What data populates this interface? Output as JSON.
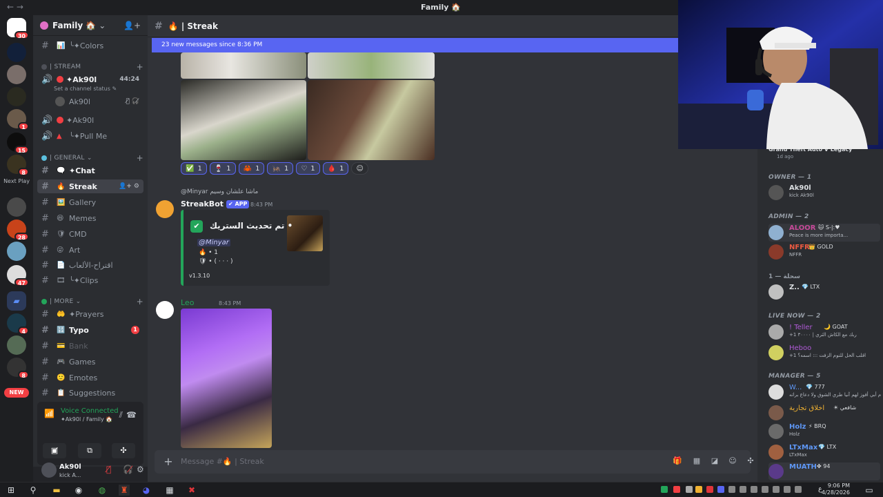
{
  "window": {
    "title": "Family 🏠",
    "nav": "←  →"
  },
  "servers": {
    "badges": [
      "30",
      "1",
      "15",
      "8",
      "28",
      "47",
      "4",
      "8"
    ],
    "next_play": "Next Play",
    "new_label": "NEW"
  },
  "guild": {
    "name": "Family 🏠",
    "chevron": "⌄"
  },
  "channels": [
    {
      "emoji": "📊",
      "label": "╰✦Colors"
    },
    {
      "emoji": "🗨️",
      "label": "✦Chat"
    },
    {
      "emoji": "🔥",
      "label": "Streak"
    },
    {
      "emoji": "🖼️",
      "label": "Gallery"
    },
    {
      "emoji": "😆",
      "label": "Memes"
    },
    {
      "emoji": "🛡",
      "label": "CMD"
    },
    {
      "emoji": "😜",
      "label": "Art"
    },
    {
      "emoji": "📄",
      "label": "اقتراح-الألعاب"
    },
    {
      "emoji": "🎞",
      "label": "╰✦Clips"
    },
    {
      "emoji": "🤲",
      "label": "✦Prayers"
    },
    {
      "emoji": "🔢",
      "label": "Typo"
    },
    {
      "emoji": "💳",
      "label": "Bank"
    },
    {
      "emoji": "🎮",
      "label": "Games"
    },
    {
      "emoji": "🙂",
      "label": "Emotes"
    },
    {
      "emoji": "📋",
      "label": "Suggestions"
    }
  ],
  "categories": {
    "stream": "| STREAM",
    "general": "| GENERAL ⌄",
    "more": "| MORE ⌄"
  },
  "voice_channels": [
    {
      "label": "✦Ak90l",
      "time": "44:24",
      "status": "Set a channel status ✎"
    },
    {
      "label": "✦Ak90l"
    },
    {
      "label": "╰✦Pull Me"
    }
  ],
  "voice_user": "Ak90l",
  "typo_badge": "1",
  "voice_panel": {
    "title": "Voice Connected",
    "sub": "✦Ak90l / Family 🏠"
  },
  "user_panel": {
    "name": "Ak90l",
    "status": "kick A..."
  },
  "chat": {
    "channel": "🔥 | Streak",
    "new_messages": "23 new messages since 8:36 PM",
    "reactions": [
      {
        "emoji": "✅",
        "count": "1"
      },
      {
        "emoji": "🍷",
        "count": "1"
      },
      {
        "emoji": "🦀",
        "count": "1"
      },
      {
        "emoji": "🦗",
        "count": "1"
      },
      {
        "emoji": "♡",
        "count": "1"
      },
      {
        "emoji": "🩸",
        "count": "1"
      },
      {
        "emoji": "☺",
        "count": ""
      }
    ],
    "reply_line": "@Minyar ماشا علشان وسيم",
    "bot_name": "StreakBot",
    "bot_tag": "✔ APP",
    "bot_time": "8:43 PM",
    "embed_title": "تم تحديث الستريك •",
    "embed_mention": "@Minyar",
    "embed_line1": "🔥 • 1",
    "embed_line2": "🛡 • (  ·  ·  ·  )",
    "embed_version": "v1.3.10",
    "user2_name": "Leo",
    "user2_time": "8:43 PM",
    "composer_placeholder": "Message #🔥 | Streak"
  },
  "members": {
    "activity": "Grand Theft Auto V Legacy",
    "activity_time": "1d ago",
    "groups": [
      {
        "title": "OWNER — 1",
        "rows": [
          {
            "name": "Ak90l",
            "status": "kick Ak90l",
            "color": "#dbdee1"
          }
        ]
      },
      {
        "title": "ADMIN — 2",
        "rows": [
          {
            "name": "ALOOR",
            "tag": "🐱 S-|:♥",
            "status": "Peace is more importa...",
            "color": "#c84a9a"
          },
          {
            "name": "NFFR",
            "tag": "👑 GOLD",
            "status": "NFFR",
            "color": "#ec5a41"
          }
        ]
      },
      {
        "title": "سحلة — 1",
        "rows": [
          {
            "name": "Z..",
            "tag": "💎 LTX",
            "status": "",
            "color": "#dbdee1"
          }
        ]
      },
      {
        "title": "LIVE NOW — 2",
        "rows": [
          {
            "name": "! Teller",
            "tag": "🌙 GOAT",
            "status": "+1 ربك مع الكاش الثري | ٣٠٠٠٠",
            "color": "#b15ad8"
          },
          {
            "name": "Heboo",
            "tag": "",
            "status": "+1 اقلب الحل للنوم الزفت ::: اسمه؟",
            "color": "#b15ad8"
          }
        ]
      },
      {
        "title": "MANAGER — 5",
        "rows": [
          {
            "name": "W...",
            "tag": "💎 777",
            "status": "م أبي أفوز لهم آنيا طري الشوق ولا دعاع براته",
            "color": "#5e97f6"
          },
          {
            "name": "اخلاق تجارية",
            "tag": "☀ شافعي",
            "status": "",
            "color": "#f0b232"
          },
          {
            "name": "Holz",
            "tag": "⚡ BRQ",
            "status": "Holz",
            "color": "#5e97f6"
          },
          {
            "name": "LTxMax",
            "tag": "💎 LTX",
            "status": "LTxMax",
            "color": "#5e97f6"
          },
          {
            "name": "MUATH",
            "tag": "✤ 94",
            "status": "",
            "color": "#5e97f6"
          }
        ]
      }
    ]
  },
  "taskbar": {
    "time": "9:06 PM",
    "date": "4/28/2026",
    "lang": "ع"
  },
  "colors": {
    "accent": "#5865f2",
    "green": "#23a55a",
    "red": "#f23f43"
  }
}
